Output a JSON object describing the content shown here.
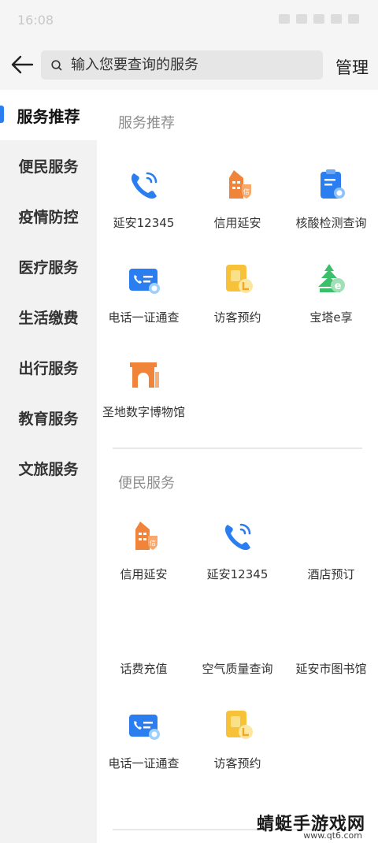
{
  "status_bar": {
    "time": "16:08"
  },
  "header": {
    "search_placeholder": "输入您要查询的服务",
    "manage_label": "管理"
  },
  "sidebar": {
    "items": [
      {
        "label": "服务推荐",
        "active": true
      },
      {
        "label": "便民服务"
      },
      {
        "label": "疫情防控"
      },
      {
        "label": "医疗服务"
      },
      {
        "label": "生活缴费"
      },
      {
        "label": "出行服务"
      },
      {
        "label": "教育服务"
      },
      {
        "label": "文旅服务"
      }
    ]
  },
  "sections": [
    {
      "title": "服务推荐",
      "tiles": [
        {
          "label": "延安12345",
          "icon": "phone-icon"
        },
        {
          "label": "信用延安",
          "icon": "credit-tower-icon"
        },
        {
          "label": "核酸检测查询",
          "icon": "clipboard-search-icon"
        },
        {
          "label": "电话一证通查",
          "icon": "phone-card-icon"
        },
        {
          "label": "访客预约",
          "icon": "visitor-card-icon"
        },
        {
          "label": "宝塔e享",
          "icon": "pagoda-e-icon"
        },
        {
          "label": "圣地数字博物馆",
          "icon": "museum-gate-icon"
        }
      ]
    },
    {
      "title": "便民服务",
      "tiles": [
        {
          "label": "信用延安",
          "icon": "credit-tower-icon"
        },
        {
          "label": "延安12345",
          "icon": "phone-icon"
        },
        {
          "label": "酒店预订",
          "icon": ""
        },
        {
          "label": "话费充值",
          "icon": ""
        },
        {
          "label": "空气质量查询",
          "icon": ""
        },
        {
          "label": "延安市图书馆",
          "icon": ""
        },
        {
          "label": "电话一证通查",
          "icon": "phone-card-icon"
        },
        {
          "label": "访客预约",
          "icon": "visitor-card-icon"
        }
      ]
    }
  ],
  "watermark": {
    "title": "蜻蜓手游戏网",
    "url": "www.qt6.com"
  },
  "colors": {
    "accent": "#2a7ef0",
    "orange": "#f0843a",
    "yellow": "#f7c23a",
    "green": "#3bbf6b"
  }
}
